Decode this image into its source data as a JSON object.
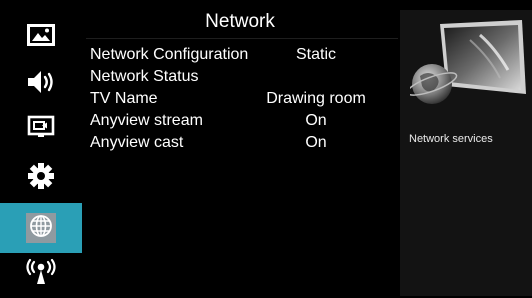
{
  "sidebar": {
    "items": [
      {
        "icon": "picture-icon",
        "active": false
      },
      {
        "icon": "speaker-icon",
        "active": false
      },
      {
        "icon": "input-source-icon",
        "active": false
      },
      {
        "icon": "gear-icon",
        "active": false
      },
      {
        "icon": "globe-icon",
        "active": true
      },
      {
        "icon": "wireless-broadcast-icon",
        "active": false
      }
    ],
    "accent_color": "#2a9fb6"
  },
  "page": {
    "title": "Network"
  },
  "menu": {
    "rows": [
      {
        "label": "Network Configuration",
        "value": "Static"
      },
      {
        "label": "Network Status",
        "value": ""
      },
      {
        "label": "TV Name",
        "value": "Drawing room"
      },
      {
        "label": "Anyview stream",
        "value": "On"
      },
      {
        "label": "Anyview cast",
        "value": "On"
      }
    ]
  },
  "info_panel": {
    "description": "Network services",
    "illustration": "globe-screen-illustration-icon"
  }
}
